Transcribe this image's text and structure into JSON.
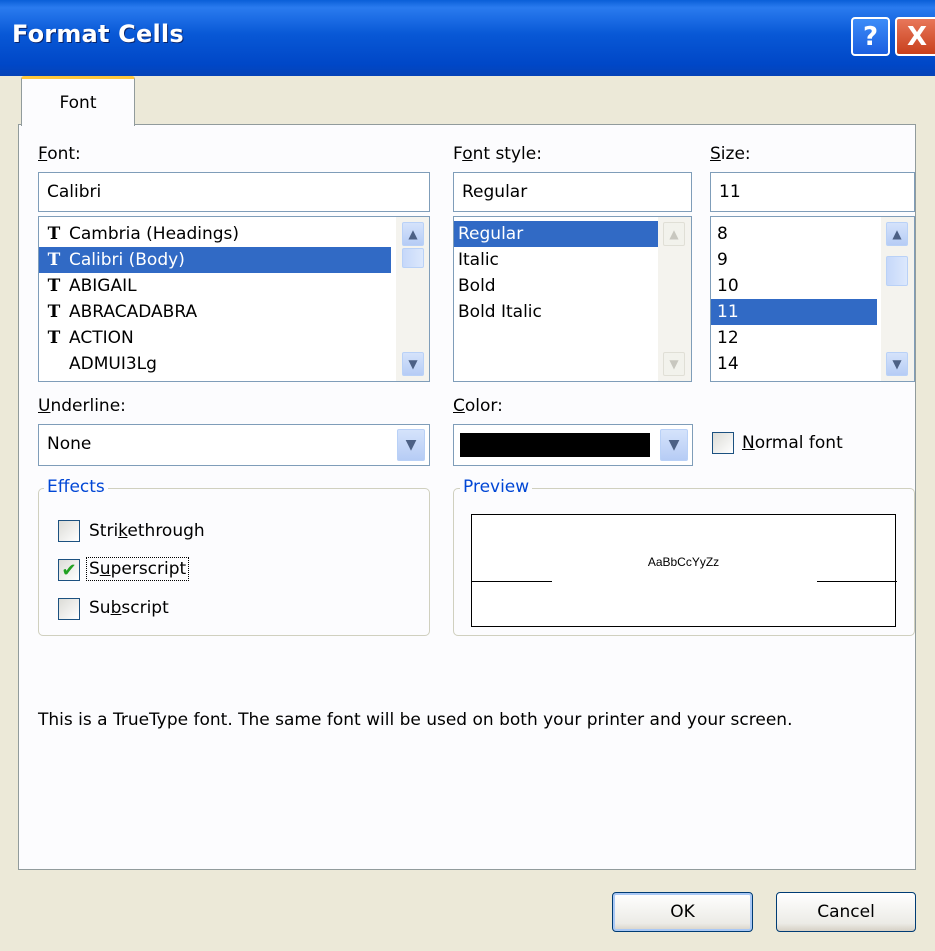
{
  "window": {
    "title": "Format Cells",
    "help_label": "?",
    "close_label": "X"
  },
  "tabs": [
    {
      "label": "Font"
    }
  ],
  "font": {
    "label": "Font:",
    "value": "Calibri",
    "items": [
      "Cambria (Headings)",
      "Calibri (Body)",
      "ABIGAIL",
      "ABRACADABRA",
      "ACTION",
      "ADMUI3Lg"
    ],
    "selected": "Calibri (Body)"
  },
  "font_style": {
    "label": "Font style:",
    "value": "Regular",
    "items": [
      "Regular",
      "Italic",
      "Bold",
      "Bold Italic"
    ],
    "selected": "Regular"
  },
  "size": {
    "label": "Size:",
    "value": "11",
    "items": [
      "8",
      "9",
      "10",
      "11",
      "12",
      "14"
    ],
    "selected": "11"
  },
  "underline": {
    "label": "Underline:",
    "value": "None"
  },
  "color": {
    "label": "Color:",
    "swatch": "#000000"
  },
  "normal_font": {
    "label": "Normal font",
    "checked": false
  },
  "effects": {
    "label": "Effects",
    "strikethrough": {
      "label": "Strikethrough",
      "checked": false
    },
    "superscript": {
      "label": "Superscript",
      "checked": true
    },
    "subscript": {
      "label": "Subscript",
      "checked": false
    }
  },
  "preview": {
    "label": "Preview",
    "sample": "AaBbCcYyZz"
  },
  "info_text": "This is a TrueType font.  The same font will be used on both your printer and your screen.",
  "buttons": {
    "ok": "OK",
    "cancel": "Cancel"
  },
  "icons": {
    "truetype": "truetype-icon",
    "checkmark": "✔"
  }
}
